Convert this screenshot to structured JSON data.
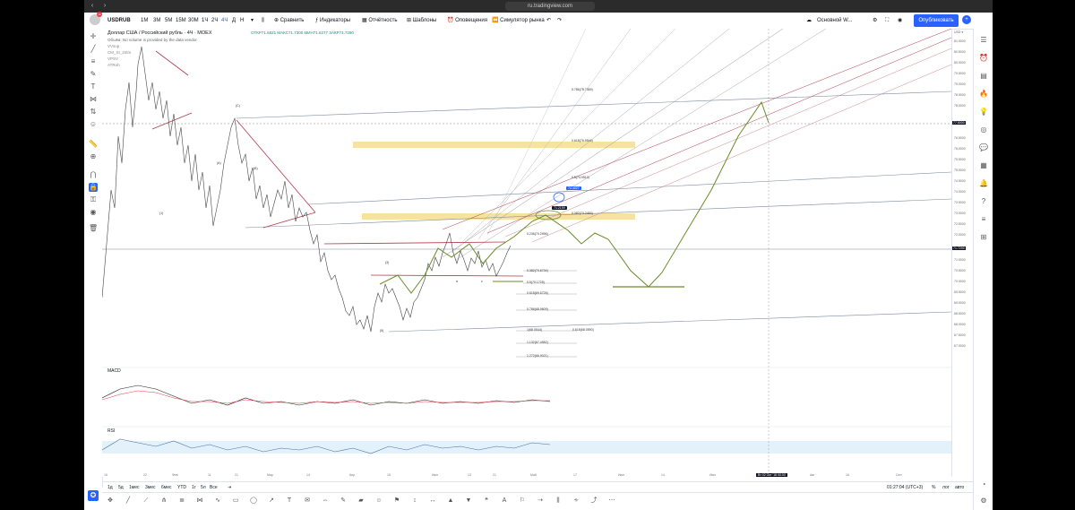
{
  "browser": {
    "url": "ru.tradingview.com",
    "back_icon": "‹",
    "forward_icon": "›",
    "tabs_badge": "16"
  },
  "toolbar": {
    "symbol": "USDRUB",
    "timeframes": [
      "1М",
      "3М",
      "5М",
      "15М",
      "30М",
      "1Ч",
      "2Ч",
      "4Ч",
      "Д",
      "Н"
    ],
    "compare": "Сравнить",
    "indicators": "Индикаторы",
    "financials": "Отчётность",
    "templates": "Шаблоны",
    "alerts": "Оповещения",
    "replay": "Симулятор рынка",
    "layout": "Основной W...",
    "publish": "Опубликовать"
  },
  "legend": {
    "title": "Доллар США / Российский рубль · 4Ч · MOEX",
    "ohlc": "ОТКР71.6821  МАКС71.7300  МИН71.6277  ЗАКР71.7290",
    "volume_note": "Объём: No volume is provided by the data vendor",
    "indicators": [
      "VVsup",
      "CM_SI_2ntm",
      "VPSV",
      "ATRoh"
    ]
  },
  "panes": {
    "macd": "MACD",
    "rsi": "RSI"
  },
  "price_axis": {
    "labels": [
      "81.0000",
      "80.5000",
      "80.0000",
      "79.5000",
      "79.0000",
      "78.5000",
      "78.0000",
      "77.5000",
      "77.0000",
      "76.5000",
      "76.0000",
      "75.5000",
      "75.0000",
      "74.5000",
      "74.0000",
      "73.5000",
      "73.0000",
      "72.5000",
      "72.0000",
      "71.5000",
      "71.0000",
      "70.5000",
      "70.0000",
      "69.5000",
      "69.0000",
      "68.5000",
      "68.0000",
      "67.5000",
      "67.0000"
    ],
    "current_price": "71.7290",
    "crosshair_price": "77.5000",
    "usd_label": "USD ▾"
  },
  "fib_levels": [
    "0.786(78.7369)",
    "0.618(76.9546)",
    "0.5(74.9510)",
    "0.382(73.2483)",
    "0.236(70.2996)",
    "0.382(70.6734)",
    "0.5(70.1725)",
    "0.618(69.6726)",
    "0.786(68.9609)",
    "1(68.0544)",
    "1.132(67.4952)",
    "1.272(66.9021)",
    "0.618(68.0590)"
  ],
  "price_tags": [
    "74.4027",
    "71.2159"
  ],
  "time_axis": {
    "labels": [
      "16",
      "22",
      "Фев",
      "11",
      "21",
      "Мар",
      "14",
      "Апр",
      "15",
      "Июн",
      "13",
      "21",
      "Май",
      "17",
      "Июн",
      "14",
      "Июл",
      "15",
      "Авг",
      "16",
      "Сен"
    ],
    "crosshair_time": "Вт 02 Окт '18  00:00"
  },
  "bottom": {
    "ranges": [
      "1д",
      "5д",
      "1мес",
      "3мес",
      "6мес",
      "YTD",
      "1г",
      "5л",
      "Все"
    ],
    "clock": "01:27:04 (UTC+3)",
    "percent": "%",
    "log": "лог",
    "auto": "авто"
  },
  "wave_labels": [
    "(1)",
    "(2)",
    "(3)",
    "(4)",
    "(5)",
    "(A)",
    "(B)",
    "(C)",
    "1",
    "2",
    "3",
    "4",
    "5",
    "a",
    "b",
    "c"
  ],
  "colors": {
    "accent": "#2962ff",
    "wave_path": "#6a8c2a",
    "fib_zone": "#f5d67a",
    "candle_up": "#555555",
    "trend_red": "#b23b4b"
  }
}
